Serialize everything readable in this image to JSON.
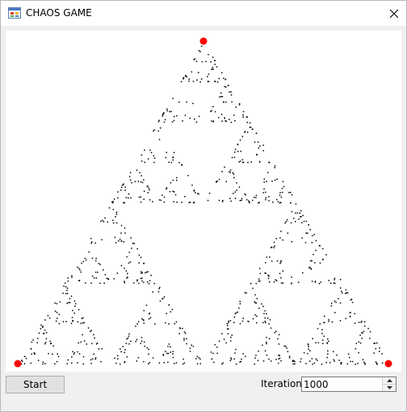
{
  "window": {
    "title": "CHAOS GAME",
    "icons": {
      "app": "app-window-icon",
      "close": "close-icon"
    }
  },
  "canvas": {
    "vertex_color": "#ff0000",
    "point_color": "#000000",
    "background": "#ffffff",
    "point_count": 1000
  },
  "controls": {
    "start_label": "Start",
    "iterations_label": "Iterations",
    "iterations_value": "1000",
    "icons": {
      "up": "spin-up-icon",
      "down": "spin-down-icon"
    }
  }
}
